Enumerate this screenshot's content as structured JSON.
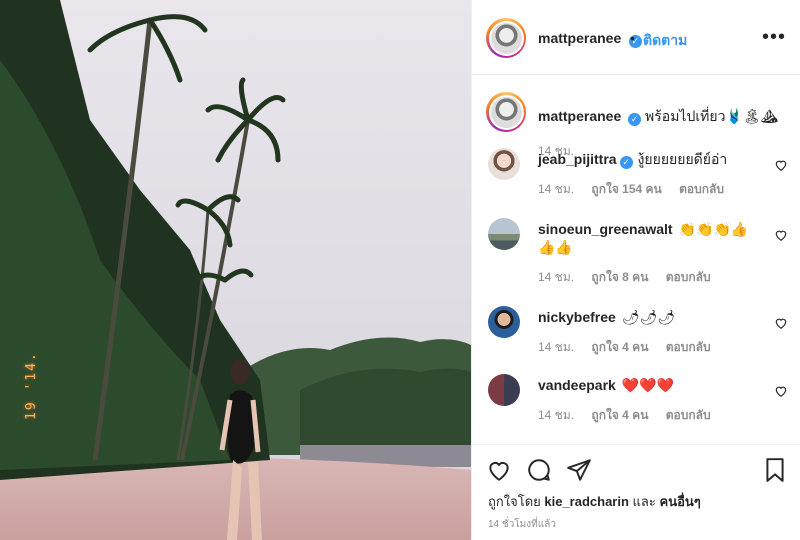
{
  "post": {
    "username": "mattperanee",
    "follow_label": "ติดตาม",
    "more_label": "•••",
    "caption": {
      "username": "mattperanee",
      "text": "พร้อมไปเที่ยว",
      "emoji": "🩱🏝⛰",
      "time": "14 ชม."
    },
    "photo_stamp": "19 '14."
  },
  "comments": [
    {
      "username": "jeab_pijittra",
      "verified": true,
      "text": "งู้ยยยยยยดีย์อ่า",
      "time": "14 ชม.",
      "likes": "ถูกใจ 154 คน",
      "reply": "ตอบกลับ"
    },
    {
      "username": "sinoeun_greenawalt",
      "verified": false,
      "text": "👏👏👏👍👍👍",
      "time": "14 ชม.",
      "likes": "ถูกใจ 8 คน",
      "reply": "ตอบกลับ"
    },
    {
      "username": "nickybefree",
      "verified": false,
      "text": "🌶🌶🌶",
      "time": "14 ชม.",
      "likes": "ถูกใจ 4 คน",
      "reply": "ตอบกลับ"
    },
    {
      "username": "vandeepark",
      "verified": false,
      "text": "❤️❤️❤️",
      "time": "14 ชม.",
      "likes": "ถูกใจ 4 คน",
      "reply": "ตอบกลับ"
    }
  ],
  "footer": {
    "liked_by_prefix": "ถูกใจโดย",
    "liked_by_user": "kie_radcharin",
    "and_label": "และ",
    "others_label": "คนอื่นๆ",
    "post_time": "14 ชั่วโมงที่แล้ว"
  },
  "colors": {
    "accent": "#3897f0",
    "heart_red": "#ed4956",
    "muted": "#8e8e8e"
  },
  "icons": [
    "verified-icon",
    "more-icon",
    "heart-icon",
    "comment-icon",
    "share-icon",
    "bookmark-icon"
  ]
}
